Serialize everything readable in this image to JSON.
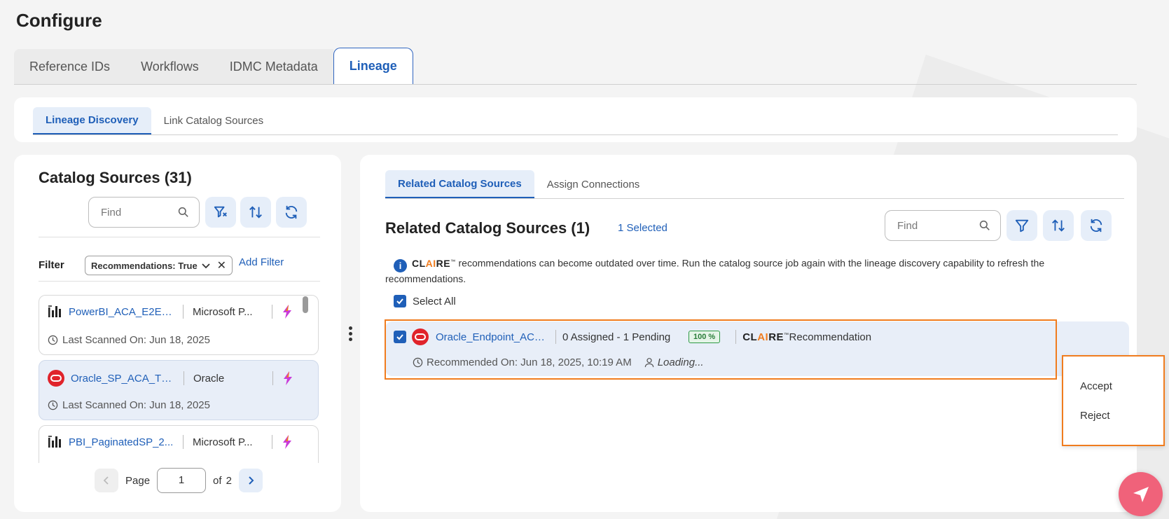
{
  "page_title": "Configure",
  "top_tabs": [
    {
      "label": "Reference IDs",
      "active": false
    },
    {
      "label": "Workflows",
      "active": false
    },
    {
      "label": "IDMC Metadata",
      "active": false
    },
    {
      "label": "Lineage",
      "active": true
    }
  ],
  "sub_tabs": [
    {
      "label": "Lineage Discovery",
      "active": true
    },
    {
      "label": "Link Catalog Sources",
      "active": false
    }
  ],
  "left": {
    "title": "Catalog Sources (31)",
    "find_placeholder": "Find",
    "filter_label": "Filter",
    "filter_chip": "Recommendations: True",
    "add_filter": "Add Filter",
    "cards": [
      {
        "name": "PowerBI_ACA_E2E_...",
        "type": "Microsoft P...",
        "last_scanned": "Last Scanned On: Jun 18, 2025",
        "icon": "powerbi-icon",
        "selected": false
      },
      {
        "name": "Oracle_SP_ACA_TC...",
        "type": "Oracle",
        "last_scanned": "Last Scanned On: Jun 18, 2025",
        "icon": "oracle-icon",
        "selected": true
      },
      {
        "name": "PBI_PaginatedSP_2...",
        "type": "Microsoft P...",
        "last_scanned": "",
        "icon": "powerbi-icon",
        "selected": false
      }
    ],
    "pager": {
      "page_label": "Page",
      "page": "1",
      "of_label": "of",
      "total": "2"
    }
  },
  "right": {
    "tabs": [
      {
        "label": "Related Catalog Sources",
        "active": true
      },
      {
        "label": "Assign Connections",
        "active": false
      }
    ],
    "title": "Related Catalog Sources (1)",
    "selected_count": "1 Selected",
    "find_placeholder": "Find",
    "info": {
      "claire_cl": "CL",
      "claire_ai": "AI",
      "claire_re": "RE",
      "tm": "™",
      "text": " recommendations can become outdated over time. Run the catalog source job again with the lineage discovery capability to refresh the recommendations."
    },
    "select_all": "Select All",
    "recommendation": {
      "name": "Oracle_Endpoint_ACA...",
      "assigned": "0 Assigned - 1 Pending",
      "confidence": "100 %",
      "source_suffix": "Recommendation",
      "recommended_on": "Recommended On: Jun 18, 2025, 10:19 AM",
      "user": "Loading..."
    },
    "menu": [
      {
        "label": "Accept"
      },
      {
        "label": "Reject"
      }
    ]
  },
  "colors": {
    "accent": "#1f5fb8",
    "highlight": "#f07c1e",
    "fab": "#f0627a"
  }
}
